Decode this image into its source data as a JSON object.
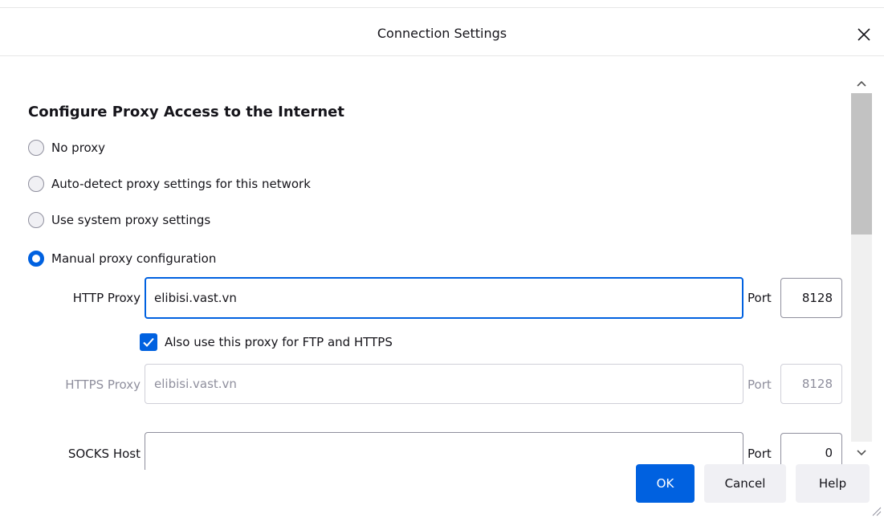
{
  "dialog": {
    "title": "Connection Settings"
  },
  "proxy": {
    "heading": "Configure Proxy Access to the Internet",
    "options": [
      {
        "label": "No proxy",
        "checked": false
      },
      {
        "label": "Auto-detect proxy settings for this network",
        "checked": false
      },
      {
        "label": "Use system proxy settings",
        "checked": false
      },
      {
        "label": "Manual proxy configuration",
        "checked": true
      }
    ],
    "http": {
      "label": "HTTP Proxy",
      "value": "elibisi.vast.vn",
      "port_label": "Port",
      "port": "8128"
    },
    "also_use": {
      "label": "Also use this proxy for FTP and HTTPS",
      "checked": true
    },
    "https": {
      "label": "HTTPS Proxy",
      "value": "elibisi.vast.vn",
      "port_label": "Port",
      "port": "8128"
    },
    "socks": {
      "label": "SOCKS Host",
      "value": "",
      "port_label": "Port",
      "port": "0"
    }
  },
  "buttons": {
    "ok": "OK",
    "cancel": "Cancel",
    "help": "Help"
  },
  "colors": {
    "accent": "#0061e0",
    "button_secondary": "#f0f0f4",
    "disabled_text": "#8f8f9d"
  },
  "icons": {
    "close": "close-icon",
    "scroll_up": "chevron-up-icon",
    "scroll_down": "chevron-down-icon",
    "check": "checkmark-icon",
    "resize": "resize-grip-icon"
  }
}
